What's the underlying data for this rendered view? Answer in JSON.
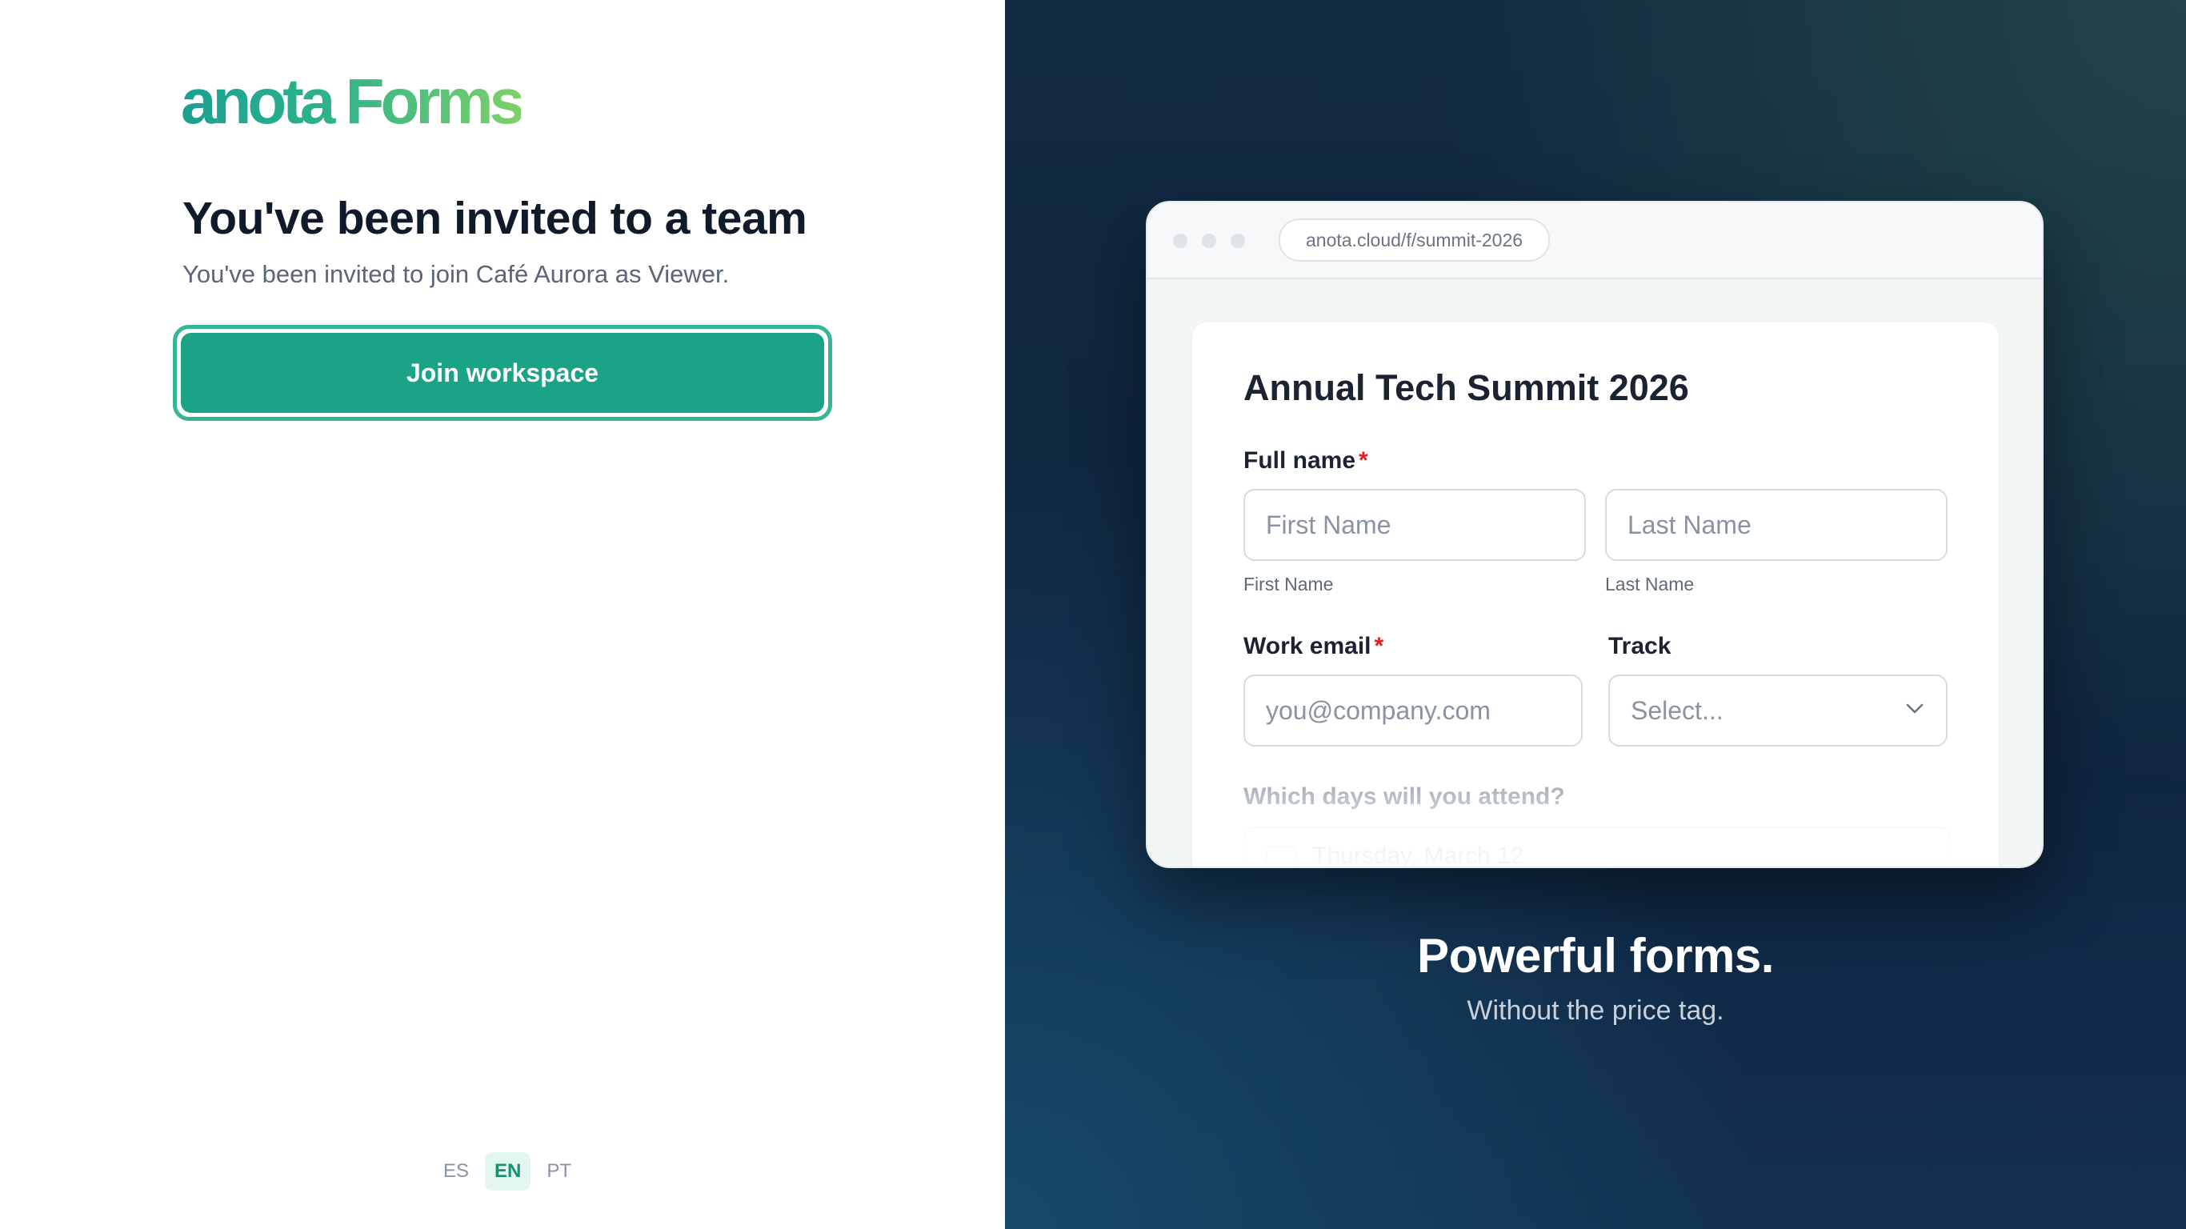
{
  "brand": {
    "logo_text": "anota Forms"
  },
  "invite": {
    "heading": "You've been invited to a team",
    "subtext": "You've been invited to join Café Aurora as Viewer.",
    "join_button_label": "Join workspace"
  },
  "languages": [
    {
      "code": "ES",
      "active": false
    },
    {
      "code": "EN",
      "active": true
    },
    {
      "code": "PT",
      "active": false
    }
  ],
  "preview": {
    "url": "anota.cloud/f/summit-2026",
    "form": {
      "title": "Annual Tech Summit 2026",
      "full_name_label": "Full name",
      "required_mark": "*",
      "first_name_placeholder": "First Name",
      "last_name_placeholder": "Last Name",
      "first_name_hint": "First Name",
      "last_name_hint": "Last Name",
      "work_email_label": "Work email",
      "email_placeholder": "you@company.com",
      "track_label": "Track",
      "track_select_value": "Select...",
      "days_question": "Which days will you attend?",
      "day_option_1": "Thursday, March 12"
    }
  },
  "marketing": {
    "tagline": "Powerful forms.",
    "subline": "Without the price tag."
  },
  "colors": {
    "accent": "#1aa386",
    "accent_border": "#35b596",
    "dark_bg": "#0f2540",
    "required": "#e02020"
  }
}
